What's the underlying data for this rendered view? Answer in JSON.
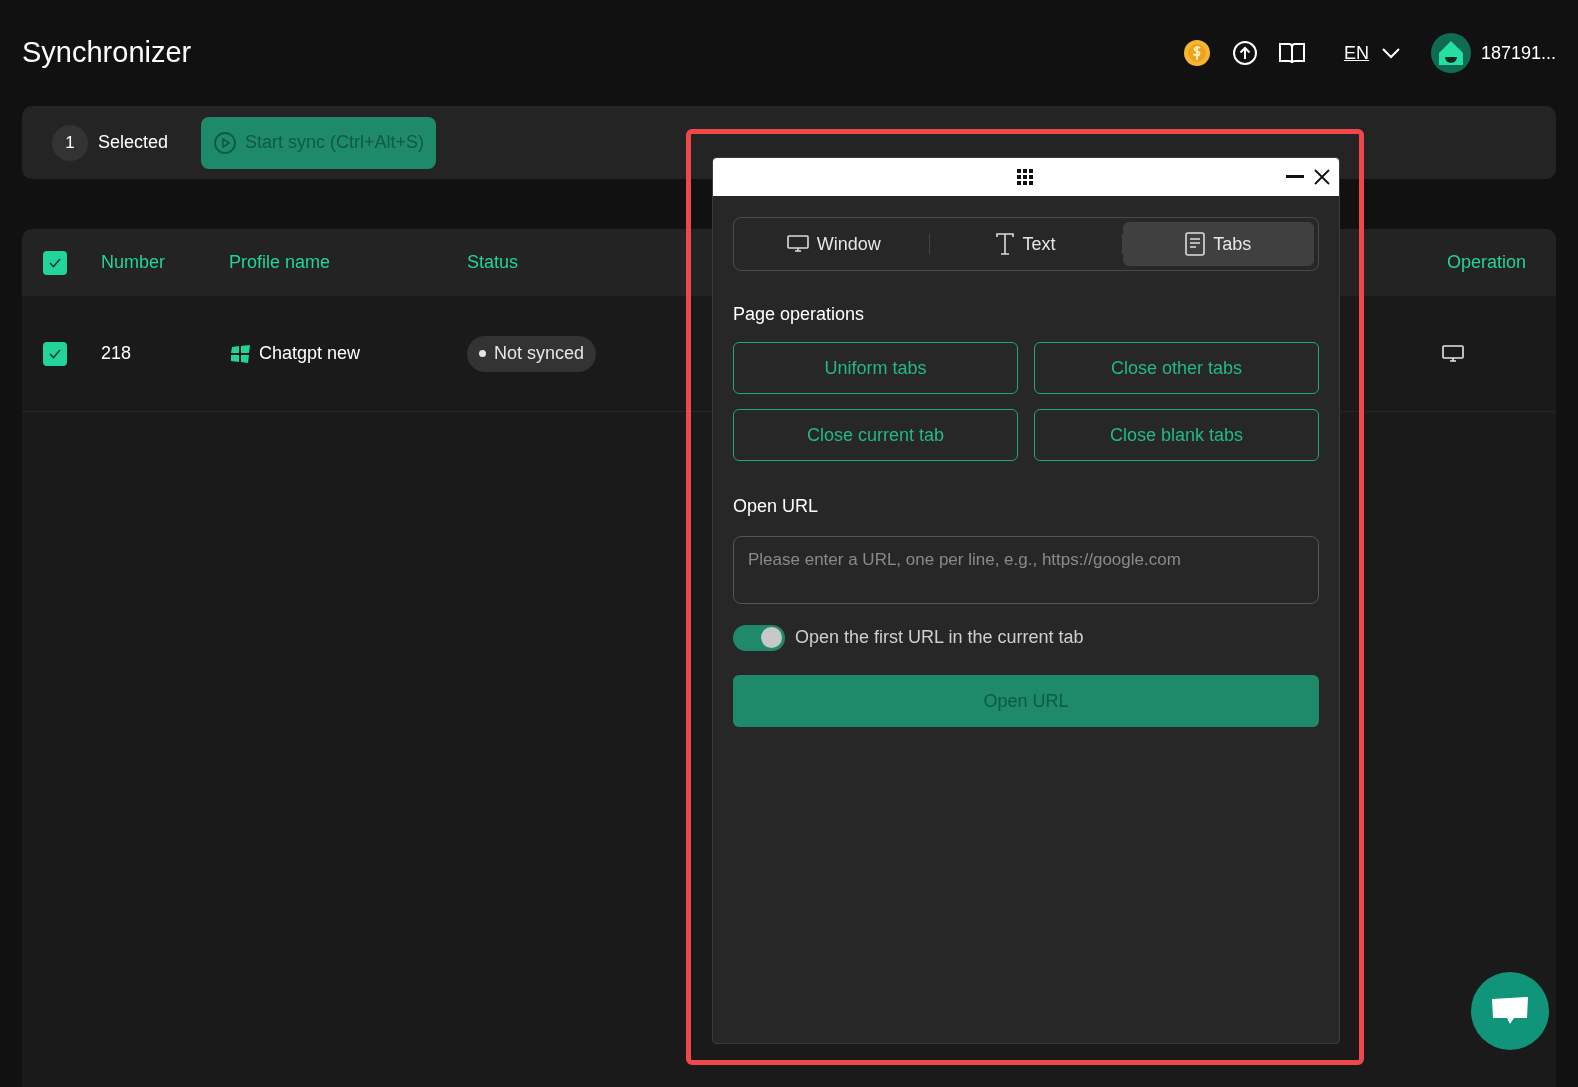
{
  "header": {
    "title": "Synchronizer",
    "language": "EN",
    "user": "187191..."
  },
  "toolbar": {
    "selected_count": "1",
    "selected_label": "Selected",
    "start_button": "Start sync (Ctrl+Alt+S)"
  },
  "table": {
    "all_checked": true,
    "columns": [
      "Number",
      "Profile name",
      "Status",
      "Operation"
    ],
    "rows": [
      {
        "checked": true,
        "number": "218",
        "profile_name": "Chatgpt new",
        "status": "Not synced"
      }
    ]
  },
  "popup": {
    "tabs": [
      {
        "label": "Window",
        "selected": false
      },
      {
        "label": "Text",
        "selected": false
      },
      {
        "label": "Tabs",
        "selected": true
      }
    ],
    "page_operations_title": "Page operations",
    "operations": [
      "Uniform tabs",
      "Close other tabs",
      "Close current tab",
      "Close blank tabs"
    ],
    "open_url_title": "Open URL",
    "url_placeholder": "Please enter a URL, one per line, e.g., https://google.com",
    "toggle": {
      "label": "Open the first URL in the current tab",
      "on": true
    },
    "open_button": "Open URL"
  }
}
